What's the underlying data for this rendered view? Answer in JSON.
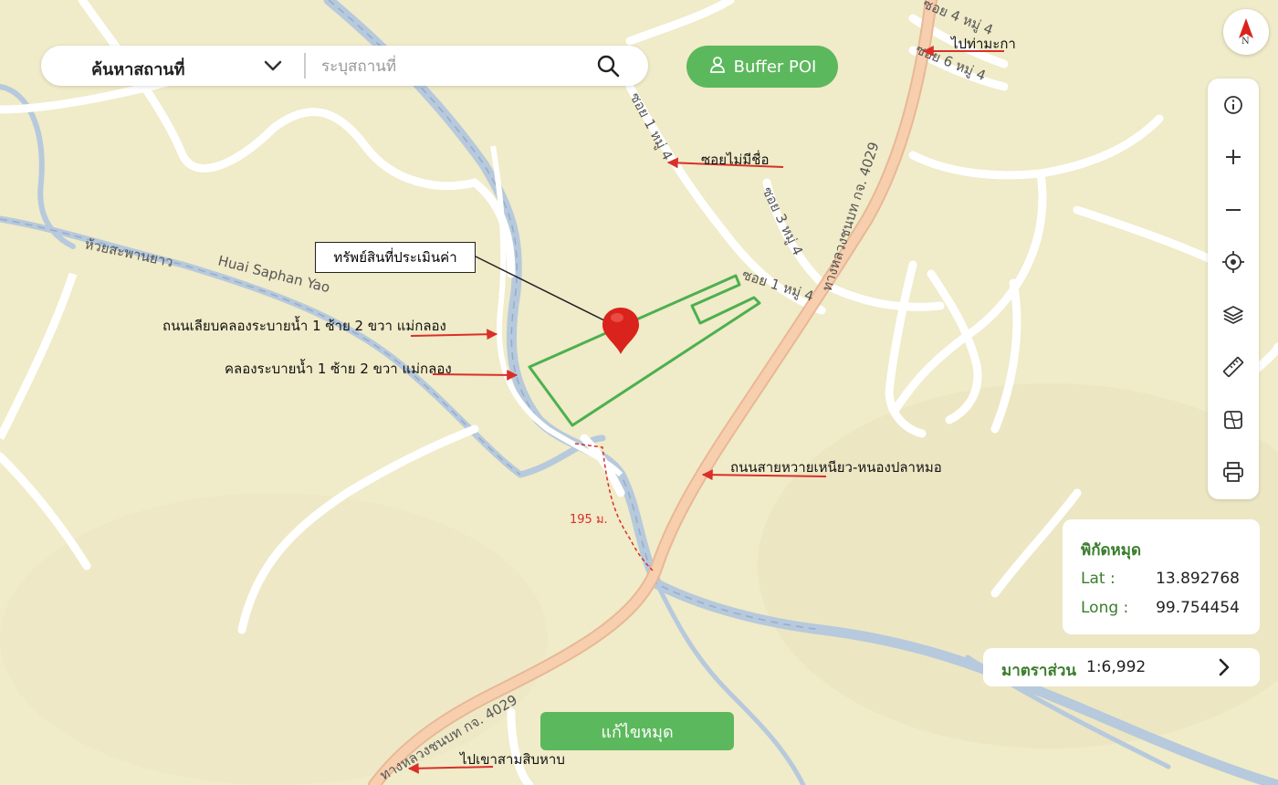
{
  "search": {
    "category": "ค้นหาสถานที่",
    "placeholder": "ระบุสถานที่"
  },
  "buffer_button": {
    "label": "Buffer POI"
  },
  "compass": {
    "label": "N"
  },
  "toolbar": {
    "tools": [
      "info-icon",
      "zoom-in-icon",
      "zoom-out-icon",
      "locate-icon",
      "layers-icon",
      "ruler-icon",
      "map-style-icon",
      "print-icon"
    ]
  },
  "coordinates": {
    "title": "พิกัดหมุด",
    "lat_label": "Lat :",
    "lat_value": "13.892768",
    "long_label": "Long :",
    "long_value": "99.754454"
  },
  "scale": {
    "label": "มาตราส่วน",
    "value": "1:6,992"
  },
  "edit_button": {
    "label": "แก้ไขหมุด"
  },
  "map": {
    "distance_label": "195 ม.",
    "road_labels": {
      "soi4": "ซอย 4 หมู่ 4",
      "soi6": "ซอย 6 หมู่ 4",
      "soi1_a": "ซอย 1 หมู่ 4",
      "soi1_b": "ซอย 1 หมู่ 4",
      "soi3": "ซอย 3 หมู่ 4",
      "highway_top": "ทางหลวงชนบท กจ. 4029",
      "highway_bottom": "ทางหลวงชนบท กจ. 4029",
      "creek_th": "ห้วยสะพานยาว",
      "creek_en": "Huai Saphan Yao"
    },
    "annotations": {
      "asset": "ทรัพย์สินที่ประเมินค่า",
      "to_tha_makha": "ไปท่ามะกา",
      "unnamed_soi": "ซอยไม่มีชื่อ",
      "canal_road": "ถนนเลียบคลองระบายน้ำ 1 ซ้าย 2 ขวา แม่กลอง",
      "canal": "คลองระบายน้ำ 1 ซ้าย 2 ขวา แม่กลอง",
      "main_road": "ถนนสายหวายเหนียว-หนองปลาหมอ",
      "to_khao_sam_sip_hap": "ไปเขาสามสิบหาบ"
    }
  },
  "colors": {
    "map_background": "#f0ebc8",
    "road": "#ffffff",
    "highway": "#f7cfae",
    "water": "#b7c9dc",
    "parcel_outline": "#4cb050",
    "annotation_arrow": "#d9302a",
    "accent_green": "#5cb85c",
    "pin": "#d9231c"
  }
}
